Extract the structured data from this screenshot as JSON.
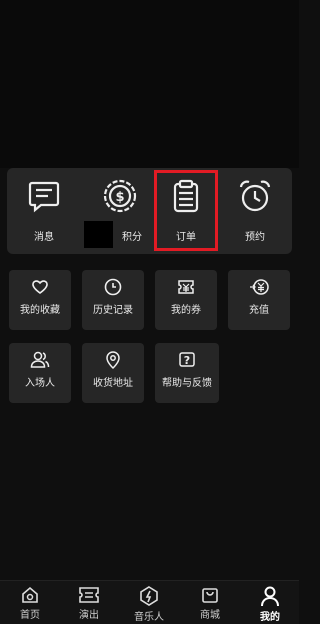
{
  "top_grid": [
    {
      "label": "消息",
      "icon": "message-icon"
    },
    {
      "label": "积分",
      "icon": "coin-icon"
    },
    {
      "label": "订单",
      "icon": "clipboard-icon"
    },
    {
      "label": "预约",
      "icon": "alarm-clock-icon"
    }
  ],
  "tiles": [
    {
      "label": "我的收藏",
      "icon": "heart-icon"
    },
    {
      "label": "历史记录",
      "icon": "clock-icon"
    },
    {
      "label": "我的券",
      "icon": "ticket-icon"
    },
    {
      "label": "充值",
      "icon": "yen-icon"
    },
    {
      "label": "入场人",
      "icon": "users-icon"
    },
    {
      "label": "收货地址",
      "icon": "location-pin-icon"
    },
    {
      "label": "帮助与反馈",
      "icon": "help-icon"
    }
  ],
  "tabbar": [
    {
      "label": "首页",
      "icon": "home-icon"
    },
    {
      "label": "演出",
      "icon": "show-ticket-icon"
    },
    {
      "label": "音乐人",
      "icon": "musician-icon"
    },
    {
      "label": "商城",
      "icon": "shop-bag-icon"
    },
    {
      "label": "我的",
      "icon": "person-icon",
      "active": true
    }
  ],
  "colors": {
    "highlight": "#e21b24",
    "card": "#262626",
    "background": "#0f0f0f"
  }
}
